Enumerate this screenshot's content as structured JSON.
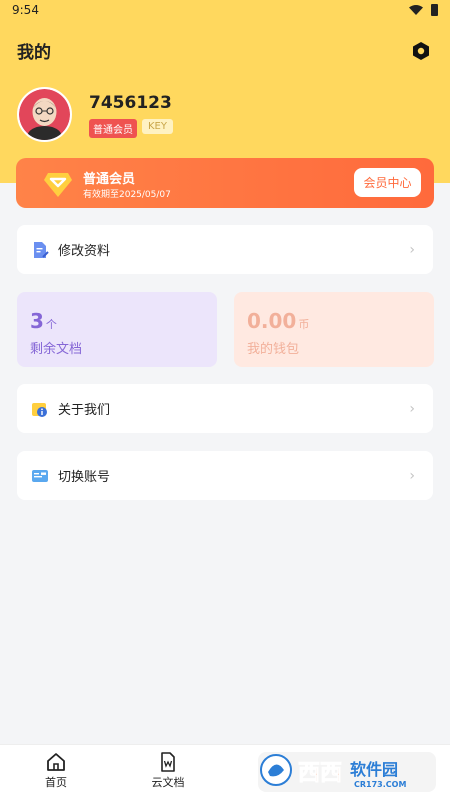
{
  "status": {
    "time": "9:54"
  },
  "header": {
    "title": "我的",
    "settings_icon": "gear-icon"
  },
  "profile": {
    "username": "7456123",
    "membership_badge": "普通会员",
    "key_badge": "KEY"
  },
  "vip": {
    "title": "普通会员",
    "expire": "有效期至2025/05/07",
    "button": "会员中心"
  },
  "menu": {
    "edit_profile": "修改资料",
    "about": "关于我们",
    "switch_account": "切换账号"
  },
  "stats": {
    "docs": {
      "value": "3",
      "unit": "个",
      "label": "剩余文档"
    },
    "wallet": {
      "value": "0.00",
      "unit": "币",
      "label": "我的钱包"
    }
  },
  "tabs": [
    {
      "label": "首页",
      "icon": "home-icon"
    },
    {
      "label": "云文档",
      "icon": "cloud-doc-icon"
    }
  ],
  "watermark": {
    "text": "西西软件园",
    "site": "CR173.COM"
  },
  "colors": {
    "header": "#ffd85e",
    "vip": "#ff6a3c",
    "docs": "#8566d6",
    "wallet": "#f2b09a"
  }
}
